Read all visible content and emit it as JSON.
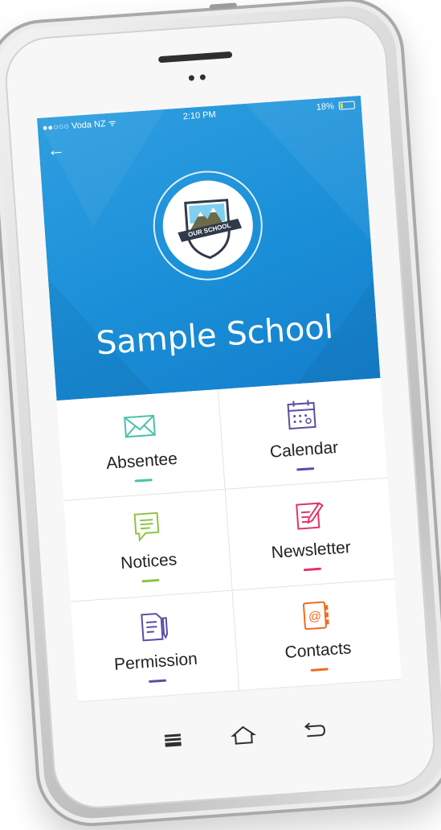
{
  "status_bar": {
    "carrier": "●●○○○ Voda NZ ᯤ",
    "time": "2:10 PM",
    "battery": "18%"
  },
  "header": {
    "logo_text": "OUR SCHOOL",
    "school_name": "Sample School",
    "background_color": "#1a8fd8"
  },
  "menu": [
    {
      "label": "Absentee",
      "icon": "envelope-icon",
      "accent": "#49c1b0"
    },
    {
      "label": "Calendar",
      "icon": "calendar-icon",
      "accent": "#5b4ea3"
    },
    {
      "label": "Notices",
      "icon": "speech-bubble-icon",
      "accent": "#8cc63f"
    },
    {
      "label": "Newsletter",
      "icon": "newsletter-edit-icon",
      "accent": "#e3336b"
    },
    {
      "label": "Permission",
      "icon": "permission-document-icon",
      "accent": "#5b4ea3"
    },
    {
      "label": "Contacts",
      "icon": "contacts-book-icon",
      "accent": "#f26a21"
    }
  ],
  "nav_bar": {
    "items": [
      "recent-apps-icon",
      "home-icon",
      "back-icon"
    ]
  }
}
